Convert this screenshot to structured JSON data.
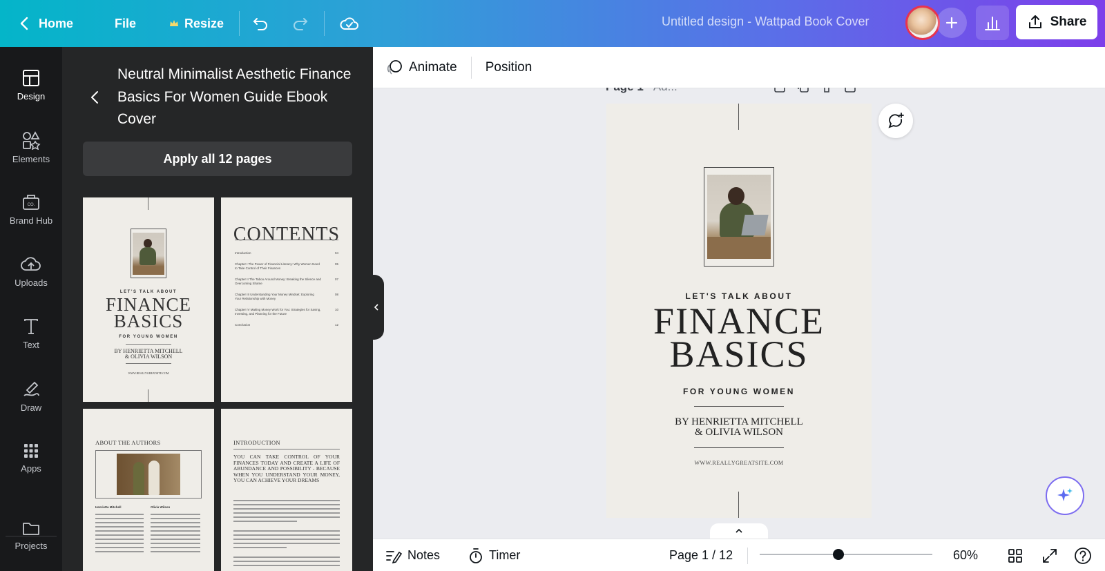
{
  "topbar": {
    "home_label": "Home",
    "file_label": "File",
    "resize_label": "Resize",
    "design_title": "Untitled design - Wattpad Book Cover",
    "share_label": "Share"
  },
  "rail": {
    "items": [
      {
        "label": "Design",
        "icon": "layout-icon"
      },
      {
        "label": "Elements",
        "icon": "shapes-icon"
      },
      {
        "label": "Brand Hub",
        "icon": "brand-icon"
      },
      {
        "label": "Uploads",
        "icon": "cloud-upload-icon"
      },
      {
        "label": "Text",
        "icon": "text-icon"
      },
      {
        "label": "Draw",
        "icon": "pen-icon"
      },
      {
        "label": "Apps",
        "icon": "grid-icon"
      },
      {
        "label": "Projects",
        "icon": "folder-icon"
      }
    ]
  },
  "panel": {
    "title": "Neutral Minimalist Aesthetic Finance Basics For Women Guide Ebook Cover",
    "apply_label": "Apply all 12 pages",
    "thumb1": {
      "sub": "LET'S TALK ABOUT",
      "title1": "FINANCE",
      "title2": "BASICS",
      "for": "FOR YOUNG WOMEN",
      "by1": "BY HENRIETTA MITCHELL",
      "by2": "& OLIVIA WILSON",
      "url": "WWW.REALLYGREATSITE.COM"
    },
    "thumb2": {
      "heading": "CONTENTS",
      "rows": [
        {
          "text": "Introduction",
          "page": "04"
        },
        {
          "text": "Chapter I The Power of Financial Literacy: Why Women Need to Take Control of Their Finances",
          "page": "05"
        },
        {
          "text": "Chapter II The Taboo Around Money: Breaking the Silence and Overcoming Shame",
          "page": "07"
        },
        {
          "text": "Chapter III Understanding Your Money Mindset: Exploring Your Relationship with Money",
          "page": "08"
        },
        {
          "text": "Chapter IV Making Money Work for You: Strategies for Saving, Investing, and Planning for the Future",
          "page": "10"
        },
        {
          "text": "Conclusion",
          "page": "12"
        }
      ]
    },
    "thumb3": {
      "heading": "ABOUT THE AUTHORS",
      "name1": "Henrietta Mitchell",
      "name2": "Olivia Wilson"
    },
    "thumb4": {
      "heading": "INTRODUCTION",
      "lead": "YOU CAN TAKE CONTROL OF YOUR FINANCES TODAY AND CREATE A LIFE OF ABUNDANCE AND POSSIBILITY - BECAUSE WHEN YOU UNDERSTAND YOUR MONEY, YOU CAN ACHIEVE YOUR DREAMS"
    }
  },
  "context_toolbar": {
    "animate_label": "Animate",
    "position_label": "Position"
  },
  "canvas": {
    "page_label": "Page 1",
    "page_title_placeholder": "Ad...",
    "cover": {
      "sub": "LET'S TALK ABOUT",
      "title1": "FINANCE",
      "title2": "BASICS",
      "for": "FOR YOUNG WOMEN",
      "by1": "BY HENRIETTA MITCHELL",
      "by2": "& OLIVIA WILSON",
      "url": "WWW.REALLYGREATSITE.COM"
    }
  },
  "bottombar": {
    "notes_label": "Notes",
    "timer_label": "Timer",
    "page_indicator": "Page 1 / 12",
    "zoom": "60%"
  }
}
